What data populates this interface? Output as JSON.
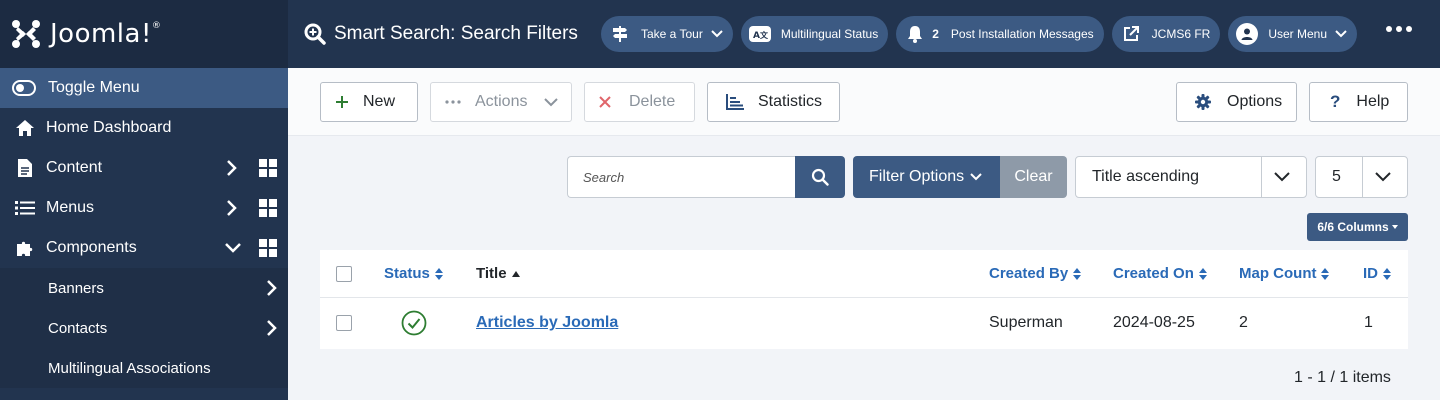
{
  "sidebar": {
    "logo_text": "Joomla!",
    "toggle_label": "Toggle Menu",
    "items": [
      {
        "label": "Home Dashboard",
        "icon": "home-icon"
      },
      {
        "label": "Content",
        "icon": "file-icon"
      },
      {
        "label": "Menus",
        "icon": "list-icon"
      },
      {
        "label": "Components",
        "icon": "puzzle-icon"
      }
    ],
    "subitems": [
      {
        "label": "Banners"
      },
      {
        "label": "Contacts"
      },
      {
        "label": "Multilingual Associations"
      }
    ]
  },
  "header": {
    "title": "Smart Search: Search Filters",
    "pills": {
      "tour": "Take a Tour",
      "multilingual": "Multilingual Status",
      "messages_count": "2",
      "messages": "Post Installation Messages",
      "site": "JCMS6 FR",
      "user": "User Menu"
    }
  },
  "toolbar": {
    "new": "New",
    "actions": "Actions",
    "delete": "Delete",
    "statistics": "Statistics",
    "options": "Options",
    "help": "Help"
  },
  "filters": {
    "search_placeholder": "Search",
    "filter_options": "Filter Options",
    "clear": "Clear",
    "sort": "Title ascending",
    "limit": "5",
    "columns": "6/6 Columns"
  },
  "table": {
    "headers": {
      "status": "Status",
      "title": "Title",
      "created_by": "Created By",
      "created_on": "Created On",
      "map_count": "Map Count",
      "id": "ID"
    },
    "rows": [
      {
        "title": "Articles by Joomla",
        "created_by": "Superman",
        "created_on": "2024-08-25",
        "map_count": "2",
        "id": "1"
      }
    ]
  },
  "pagination": "1 - 1 / 1 items",
  "colors": {
    "sidebar": "#22344f",
    "accent": "#3c5a83",
    "link": "#2a6ab7",
    "success": "#2e7d32"
  }
}
